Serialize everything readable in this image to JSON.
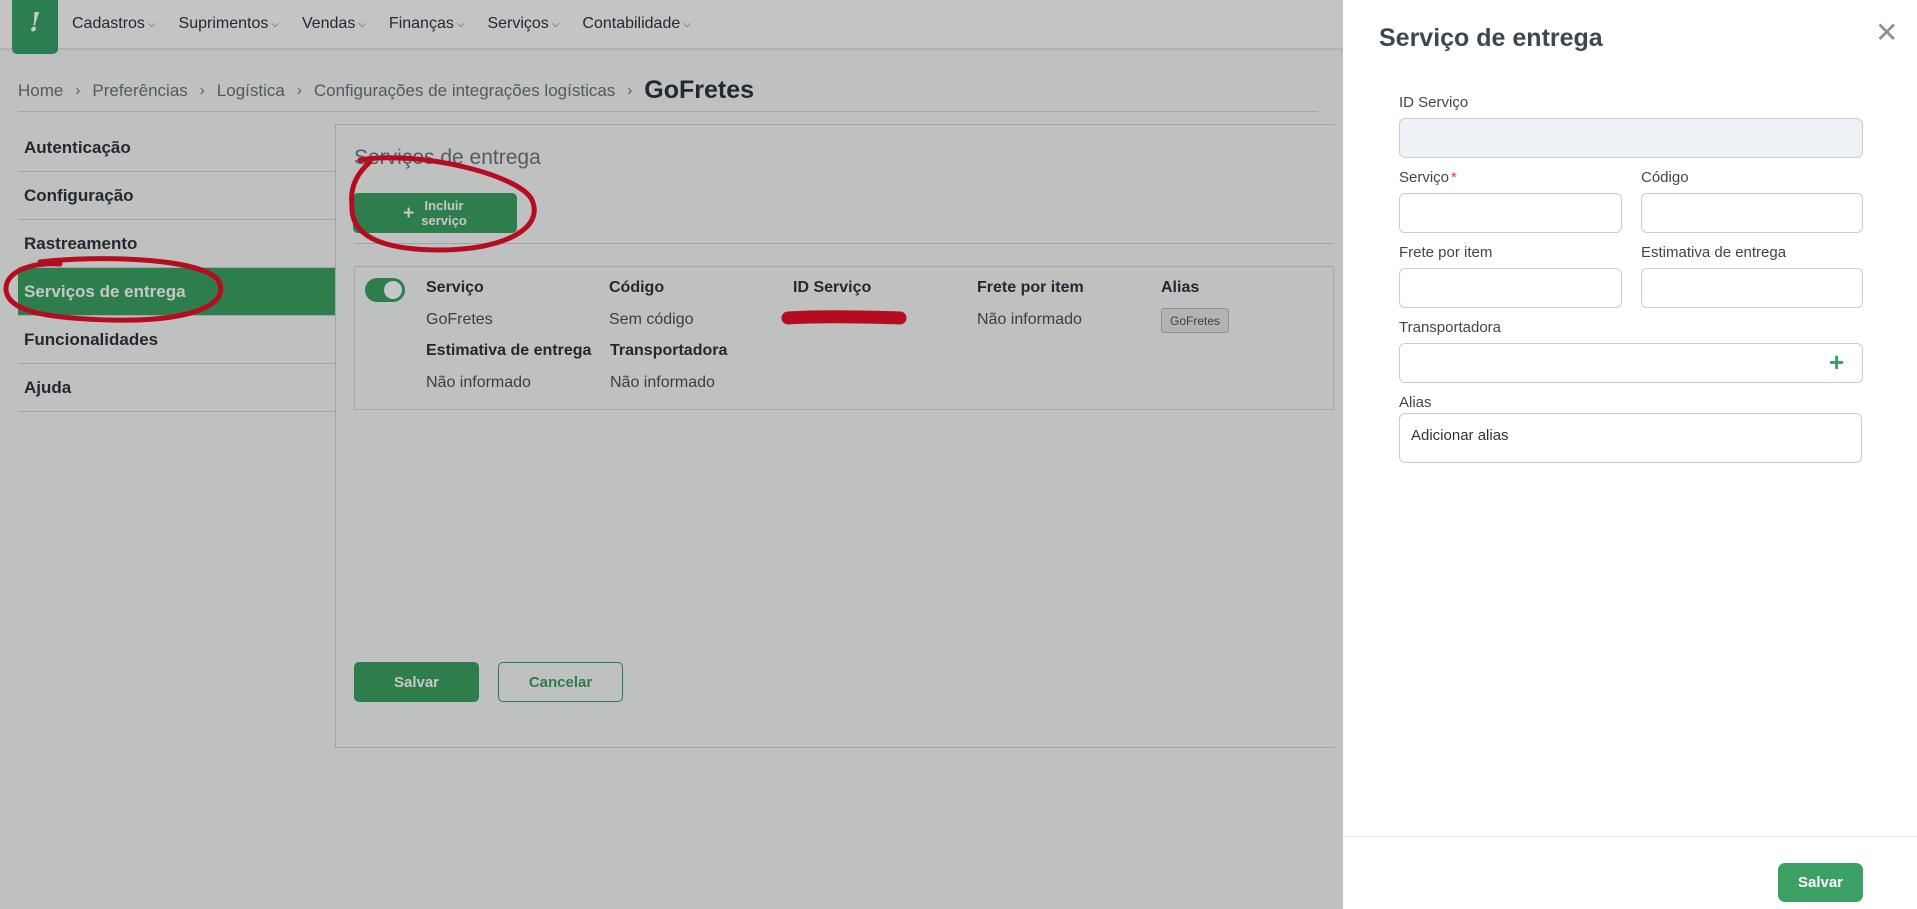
{
  "nav": {
    "logo_glyph": "!",
    "menu": [
      {
        "label": "Cadastros"
      },
      {
        "label": "Suprimentos"
      },
      {
        "label": "Vendas"
      },
      {
        "label": "Finanças"
      },
      {
        "label": "Serviços"
      },
      {
        "label": "Contabilidade"
      }
    ],
    "chevron": "⌵"
  },
  "breadcrumb": {
    "items": [
      "Home",
      "Preferências",
      "Logística",
      "Configurações de integrações logísticas"
    ],
    "current": "GoFretes",
    "separator": "›"
  },
  "sidebar": {
    "items": [
      {
        "label": "Autenticação"
      },
      {
        "label": "Configuração"
      },
      {
        "label": "Rastreamento"
      },
      {
        "label": "Serviços de entrega"
      },
      {
        "label": "Funcionalidades"
      },
      {
        "label": "Ajuda"
      }
    ],
    "active": "Serviços de entrega"
  },
  "section": {
    "title": "Serviços de entrega",
    "add_button_line1": "Incluir",
    "add_button_line2": "serviço",
    "add_icon": "+"
  },
  "service_card": {
    "enabled": true,
    "headers": {
      "servico": "Serviço",
      "codigo": "Código",
      "id_servico": "ID Serviço",
      "frete": "Frete por item",
      "alias": "Alias",
      "estimativa": "Estimativa de entrega",
      "transportadora": "Transportadora"
    },
    "values": {
      "servico": "GoFretes",
      "codigo": "Sem código",
      "frete": "Não informado",
      "alias_chip": "GoFretes",
      "estimativa": "Não informado",
      "transportadora": "Não informado"
    }
  },
  "form_buttons": {
    "save": "Salvar",
    "cancel": "Cancelar"
  },
  "drawer": {
    "title": "Serviço de entrega",
    "close_icon": "✕",
    "fields": {
      "id_servico": {
        "label": "ID Serviço",
        "value": ""
      },
      "servico": {
        "label": "Serviço",
        "required_mark": "*",
        "value": ""
      },
      "codigo": {
        "label": "Código",
        "value": ""
      },
      "frete": {
        "label": "Frete por item",
        "value": ""
      },
      "estimativa": {
        "label": "Estimativa de entrega",
        "value": ""
      },
      "transportadora": {
        "label": "Transportadora",
        "value": ""
      },
      "alias": {
        "label": "Alias",
        "placeholder": "Adicionar alias"
      }
    },
    "add_icon": "+",
    "save_label": "Salvar"
  },
  "colors": {
    "brand_green": "#3ba063",
    "annotation_red": "#e8102a",
    "required_red": "#e53e3e"
  },
  "icons": {
    "close": "close-icon",
    "add": "plus-icon",
    "separator": "chevron-right-icon",
    "menu_dropdown": "chevron-down-icon"
  }
}
